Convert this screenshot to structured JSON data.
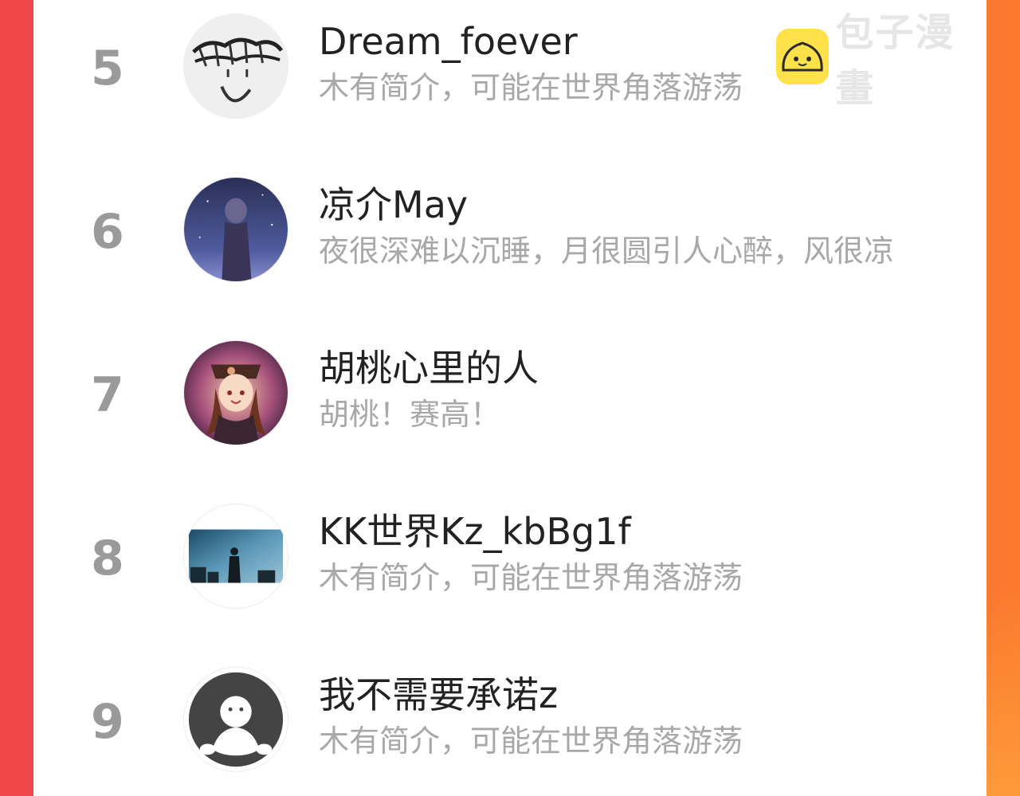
{
  "watermark": {
    "text": "包子漫畫",
    "icon": "bun-logo-icon"
  },
  "rankings": [
    {
      "rank": "5",
      "name": "Dream_foever",
      "bio": "木有简介，可能在世界角落游荡",
      "avatar": "sketch-avatar"
    },
    {
      "rank": "6",
      "name": "凉介May",
      "bio": "夜很深难以沉睡，月很圆引人心醉，风很凉",
      "avatar": "night-sky-avatar"
    },
    {
      "rank": "7",
      "name": "胡桃心里的人",
      "bio": "胡桃！赛高！",
      "avatar": "anime-girl-avatar"
    },
    {
      "rank": "8",
      "name": "KK世界Kz_kbBg1f",
      "bio": "木有简介，可能在世界角落游荡",
      "avatar": "silhouette-avatar"
    },
    {
      "rank": "9",
      "name": "我不需要承诺z",
      "bio": "木有简介，可能在世界角落游荡",
      "avatar": "default-avatar"
    }
  ],
  "colors": {
    "rank": "#9a9a9a",
    "name": "#222222",
    "bio": "#a8a8a8",
    "accent_left": "#f0474b",
    "accent_right": "#fb7a2e",
    "logo": "#ffe14a"
  }
}
